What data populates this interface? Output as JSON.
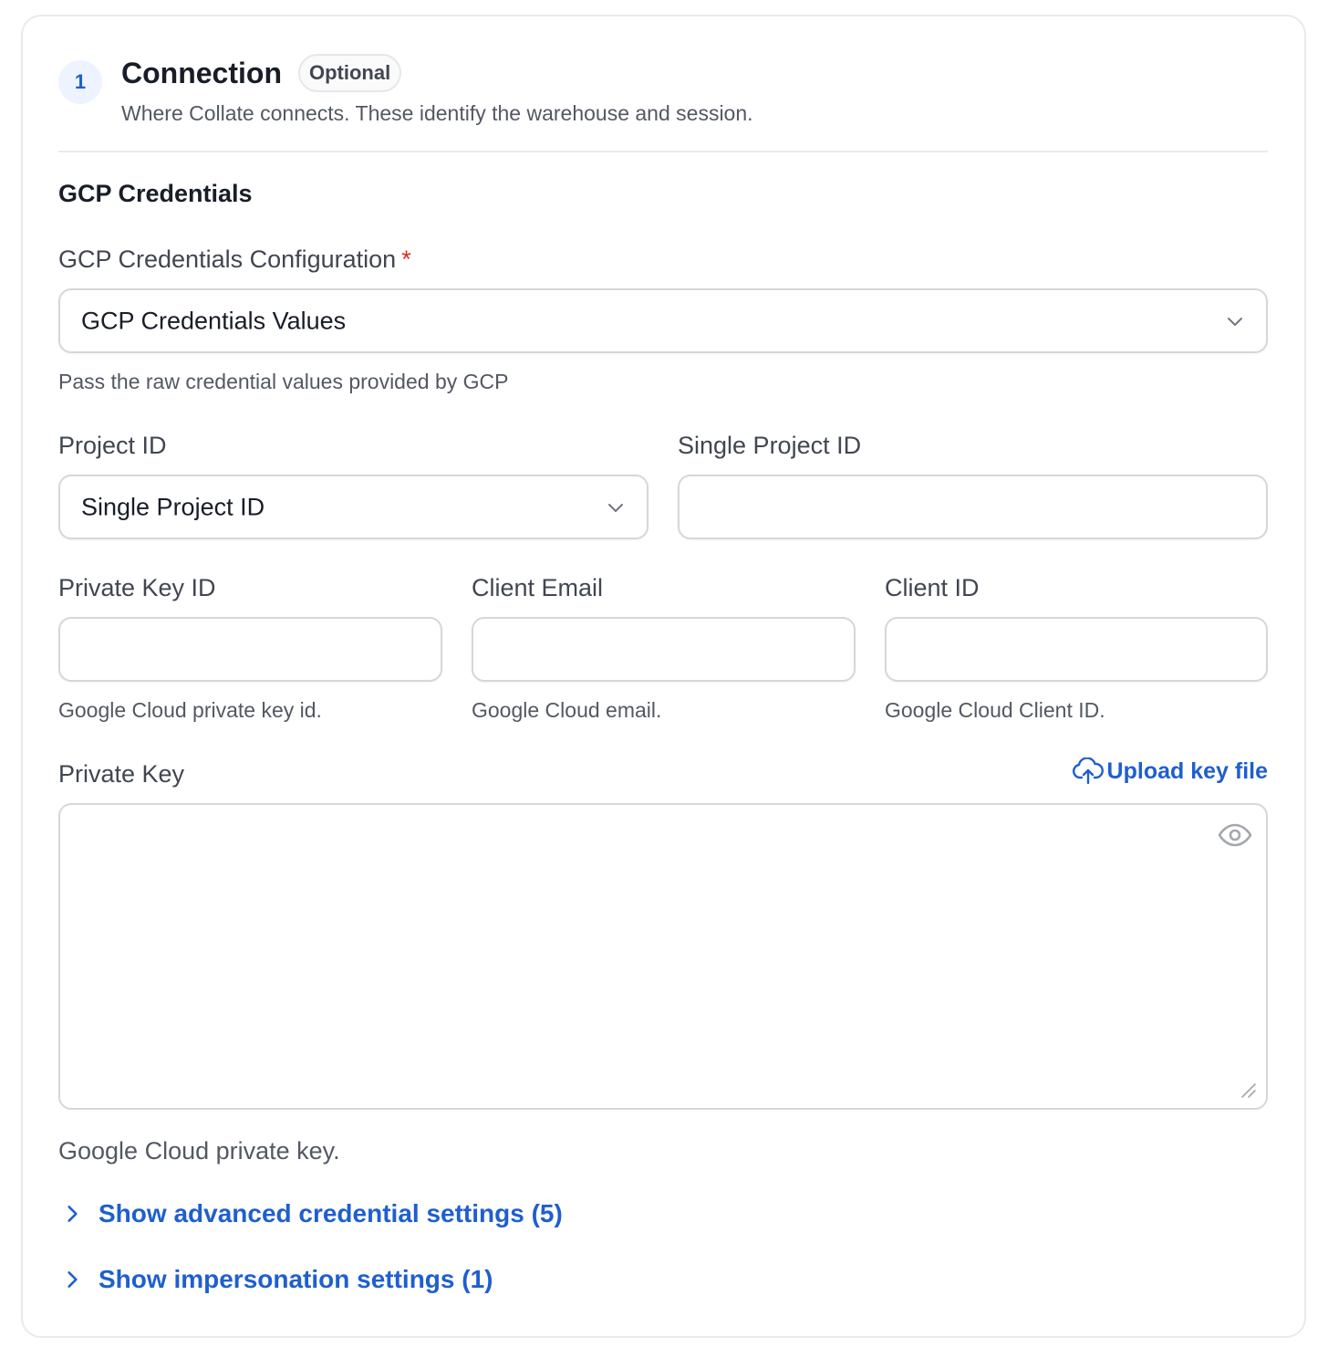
{
  "step": {
    "number": "1",
    "title": "Connection",
    "badge": "Optional",
    "subtitle": "Where Collate connects. These identify the warehouse and session."
  },
  "section": {
    "title": "GCP Credentials"
  },
  "config": {
    "label": "GCP Credentials Configuration",
    "required_mark": "*",
    "value": "GCP Credentials Values",
    "hint": "Pass the raw credential values provided by GCP"
  },
  "project": {
    "label": "Project ID",
    "value": "Single Project ID",
    "single_label": "Single Project ID",
    "single_value": ""
  },
  "private_key_id": {
    "label": "Private Key ID",
    "value": "",
    "hint": "Google Cloud private key id."
  },
  "client_email": {
    "label": "Client Email",
    "value": "",
    "hint": "Google Cloud email."
  },
  "client_id": {
    "label": "Client ID",
    "value": "",
    "hint": "Google Cloud Client ID."
  },
  "private_key": {
    "label": "Private Key",
    "upload_label": "Upload key file",
    "value": "",
    "hint": "Google Cloud private key."
  },
  "toggles": {
    "advanced": "Show advanced credential settings (5)",
    "impersonation": "Show impersonation settings (1)"
  },
  "colors": {
    "accent": "#1f5fcf",
    "required": "#d92d20",
    "border": "#d5d7da"
  },
  "icons": {
    "chevron": "chevron-down-icon",
    "upload": "upload-cloud-icon",
    "eye": "eye-icon",
    "expand": "chevron-right-icon"
  }
}
